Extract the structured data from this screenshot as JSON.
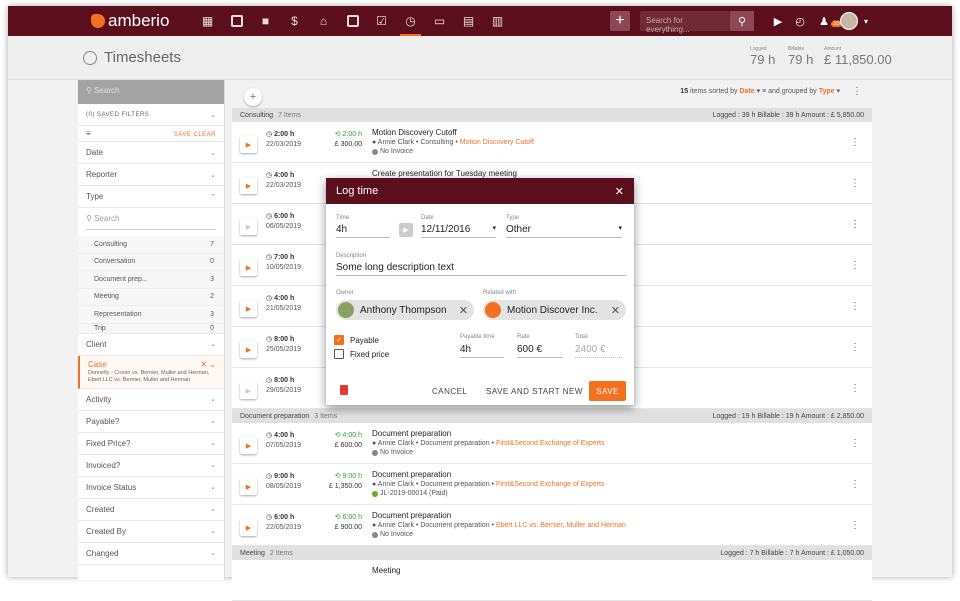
{
  "app": {
    "name": "amberio"
  },
  "topbar": {
    "search_placeholder": "Search for everything...",
    "notification_count": "20"
  },
  "header": {
    "title": "Timesheets",
    "stats": [
      {
        "label": "Logged",
        "value": "79 h"
      },
      {
        "label": "Billable",
        "value": "79 h"
      },
      {
        "label": "Amount",
        "value": "£ 11,850.00"
      }
    ]
  },
  "sidebar": {
    "search_placeholder": "Search",
    "saved_filters": "(0) SAVED FILTERS",
    "save": "SAVE",
    "clear": "CLEAR",
    "filters_top": [
      "Date",
      "Reporter",
      "Type"
    ],
    "type_search": "Search",
    "type_items": [
      {
        "label": "Consulting",
        "count": "7"
      },
      {
        "label": "Conversation",
        "count": "0"
      },
      {
        "label": "Document prep...",
        "count": "3"
      },
      {
        "label": "Meeting",
        "count": "2"
      },
      {
        "label": "Representation",
        "count": "3"
      },
      {
        "label": "Trip",
        "count": "0"
      }
    ],
    "client": "Client",
    "case": {
      "label": "Case",
      "value": "Donnelly - Cronin vs. Bernier, Muller and Herman, Ebert LLC vs. Bernier, Muller and Herman"
    },
    "filters_bottom": [
      "Activity",
      "Payable?",
      "Fixed Price?",
      "Invoiced?",
      "Invoice Status",
      "Created",
      "Created By",
      "Changed"
    ]
  },
  "list": {
    "count": "15",
    "sort_text": "items sorted by",
    "sort_field": "Date",
    "group_text": "and grouped by",
    "group_field": "Type",
    "groups": [
      {
        "name": "Consulting",
        "count": "7 Items",
        "summary": "Logged : 39 h  Billable : 39 h  Amount : £ 5,850.00"
      },
      {
        "name": "Document preparation",
        "count": "3 Items",
        "summary": "Logged : 19 h  Billable : 19 h  Amount : £ 2,850.00"
      },
      {
        "name": "Meeting",
        "count": "2 Items",
        "summary": "Logged : 7 h  Billable : 7 h  Amount : £ 1,050.00"
      }
    ],
    "rows_consulting": [
      {
        "time": "2:00 h",
        "date": "22/03/2019",
        "billable": "2:00 h",
        "amount": "£ 300.00",
        "title": "Motion Discovery Cutoff",
        "meta": "Annie Clark • Consulting •",
        "link": "Motion Discovery Cutoff",
        "invoice": "No Invoice"
      },
      {
        "time": "4:00 h",
        "date": "22/03/2019",
        "billable": "",
        "amount": "",
        "title": "Create presentation for Tuesday meeting",
        "meta": "",
        "link": "",
        "invoice": ""
      },
      {
        "time": "6:00 h",
        "date": "06/05/2019",
        "billable": "",
        "amount": "",
        "title": "",
        "meta": "",
        "link": "",
        "invoice": ""
      },
      {
        "time": "7:00 h",
        "date": "10/05/2019",
        "billable": "",
        "amount": "",
        "title": "",
        "meta": "",
        "link": "",
        "invoice": ""
      },
      {
        "time": "4:00 h",
        "date": "21/05/2019",
        "billable": "",
        "amount": "",
        "title": "",
        "meta": "",
        "link": "",
        "invoice": ""
      },
      {
        "time": "8:00 h",
        "date": "25/05/2019",
        "billable": "",
        "amount": "",
        "title": "",
        "meta": "",
        "link": "",
        "invoice": ""
      },
      {
        "time": "8:00 h",
        "date": "29/05/2019",
        "billable": "",
        "amount": "",
        "title": "",
        "meta": "",
        "link": "",
        "invoice": ""
      }
    ],
    "rows_docprep": [
      {
        "time": "4:00 h",
        "date": "07/05/2019",
        "billable": "4:00 h",
        "amount": "£ 600.00",
        "title": "Document preparation",
        "meta": "Annie Clark • Document preparation •",
        "link": "First&Second Exchange of Experts",
        "invoice": "No Invoice"
      },
      {
        "time": "9:00 h",
        "date": "08/05/2019",
        "billable": "9:00 h",
        "amount": "£ 1,350.00",
        "title": "Document preparation",
        "meta": "Annie Clark • Document preparation •",
        "link": "First&Second Exchange of Experts",
        "invoice": "JL-2019-00014 (Paid)"
      },
      {
        "time": "6:00 h",
        "date": "22/05/2019",
        "billable": "6:00 h",
        "amount": "£ 900.00",
        "title": "Document preparation",
        "meta": "Annie Clark • Document preparation •",
        "link": "Ebert LLC vs. Bernier, Muller and Herman",
        "invoice": "No Invoice"
      }
    ],
    "row_meeting_title": "Meeting"
  },
  "modal": {
    "title": "Log time",
    "time_label": "Time",
    "time_value": "4h",
    "date_label": "Date",
    "date_value": "12/11/2016",
    "type_label": "Type",
    "type_value": "Other",
    "desc_label": "Description",
    "desc_value": "Some long description text",
    "owner_label": "Owner",
    "owner_value": "Anthony Thompson",
    "related_label": "Related with",
    "related_value": "Motion Discover Inc.",
    "payable_label": "Payable",
    "fixed_label": "Fixed price",
    "ptime_label": "Payable time",
    "ptime_value": "4h",
    "rate_label": "Rate",
    "rate_value": "600 €",
    "total_label": "Total",
    "total_value": "2400 €",
    "cancel": "CANCEL",
    "save_new": "SAVE AND START NEW",
    "save": "SAVE"
  }
}
